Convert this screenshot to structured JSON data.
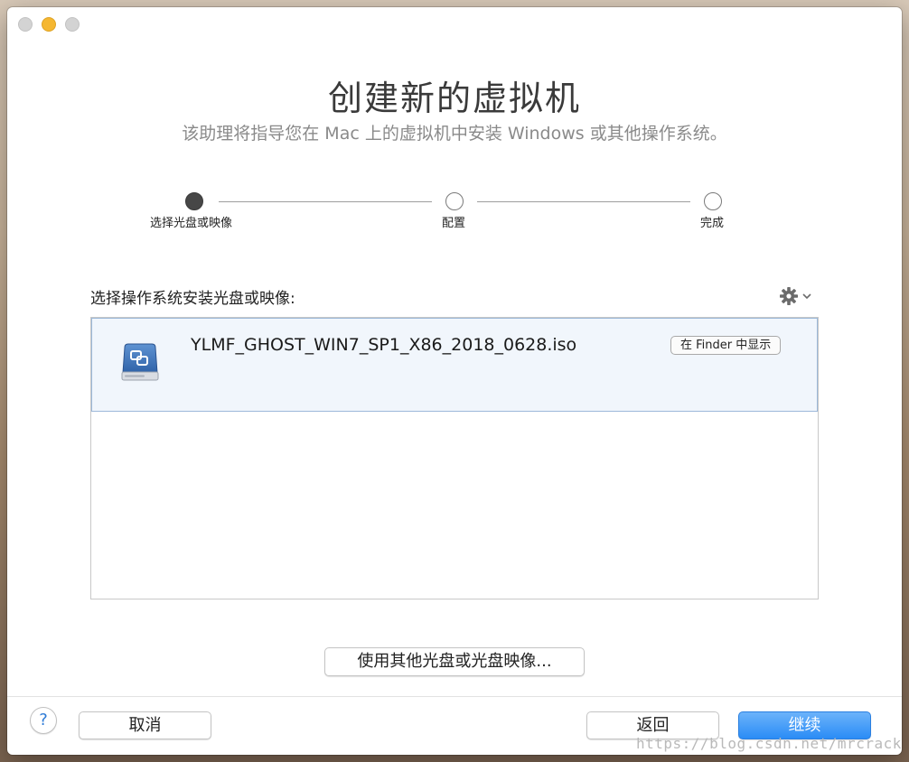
{
  "window": {
    "title": "创建新的虚拟机",
    "subtitle": "该助理将指导您在 Mac 上的虚拟机中安装 Windows 或其他操作系统。"
  },
  "steps": [
    {
      "label": "选择光盘或映像",
      "state": "active"
    },
    {
      "label": "配置",
      "state": "pending"
    },
    {
      "label": "完成",
      "state": "pending"
    }
  ],
  "source": {
    "label": "选择操作系统安装光盘或映像:",
    "items": [
      {
        "name": "YLMF_GHOST_WIN7_SP1_X86_2018_0628.iso",
        "action_label": "在 Finder 中显示",
        "icon": "disk-image-icon",
        "selected": true
      }
    ]
  },
  "buttons": {
    "other_disc": "使用其他光盘或光盘映像...",
    "help": "?",
    "cancel": "取消",
    "back": "返回",
    "continue": "继续"
  },
  "watermark": "https://blog.csdn.net/mrcrack",
  "colors": {
    "accent": "#2a8cf6",
    "selection_bg": "#f1f6fc",
    "selection_border": "#9cb8d9"
  }
}
